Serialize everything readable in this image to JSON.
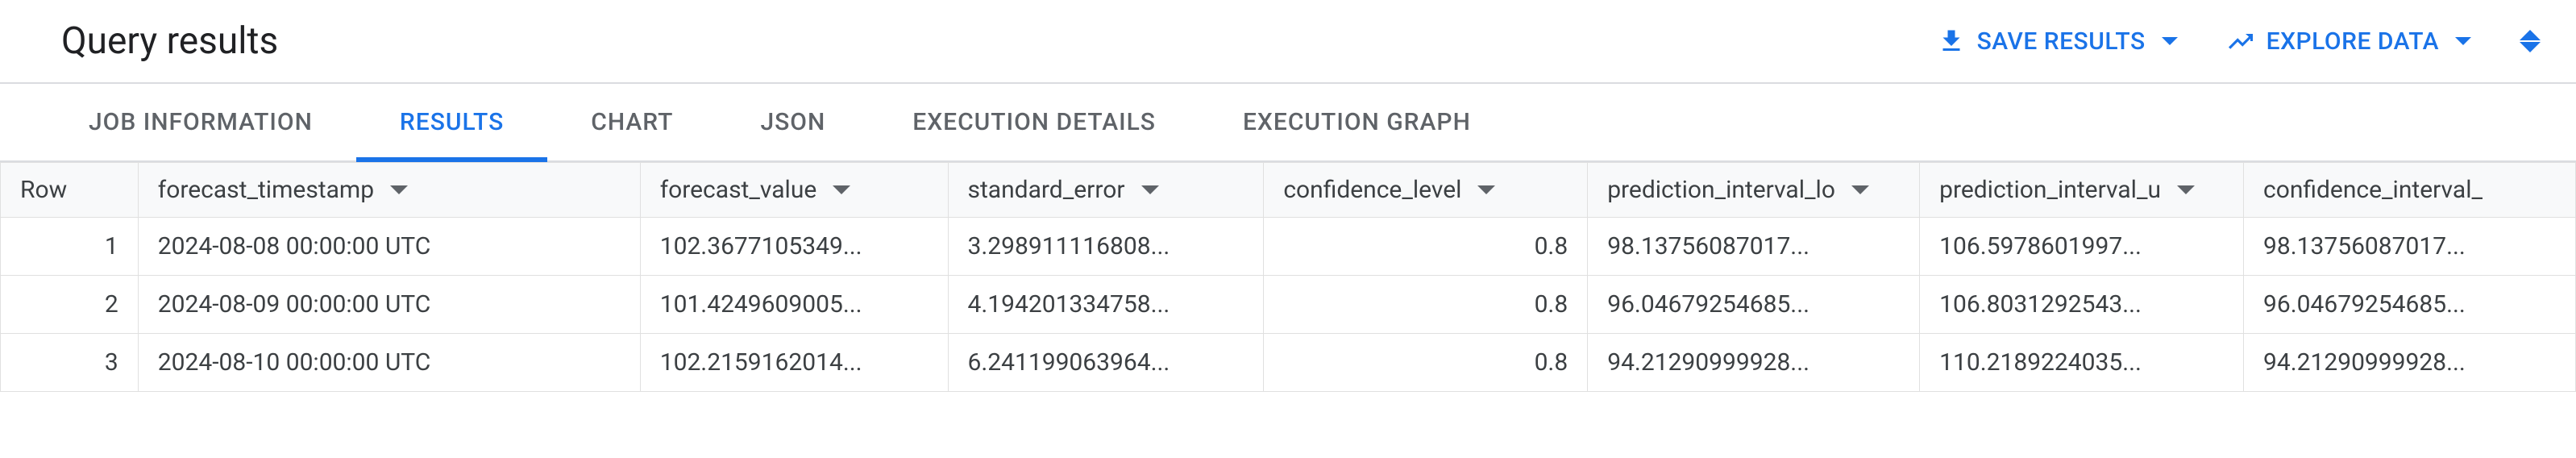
{
  "header": {
    "title": "Query results",
    "save_results_label": "SAVE RESULTS",
    "explore_data_label": "EXPLORE DATA"
  },
  "tabs": [
    {
      "label": "JOB INFORMATION",
      "active": false
    },
    {
      "label": "RESULTS",
      "active": true
    },
    {
      "label": "CHART",
      "active": false
    },
    {
      "label": "JSON",
      "active": false
    },
    {
      "label": "EXECUTION DETAILS",
      "active": false
    },
    {
      "label": "EXECUTION GRAPH",
      "active": false
    }
  ],
  "columns": {
    "row": "Row",
    "forecast_timestamp": "forecast_timestamp",
    "forecast_value": "forecast_value",
    "standard_error": "standard_error",
    "confidence_level": "confidence_level",
    "prediction_interval_lower": "prediction_interval_lo",
    "prediction_interval_upper": "prediction_interval_u",
    "confidence_interval_lower": "confidence_interval_"
  },
  "rows": [
    {
      "row": "1",
      "forecast_timestamp": "2024-08-08 00:00:00 UTC",
      "forecast_value": "102.3677105349...",
      "standard_error": "3.298911116808...",
      "confidence_level": "0.8",
      "prediction_interval_lower": "98.13756087017...",
      "prediction_interval_upper": "106.5978601997...",
      "confidence_interval_lower": "98.13756087017..."
    },
    {
      "row": "2",
      "forecast_timestamp": "2024-08-09 00:00:00 UTC",
      "forecast_value": "101.4249609005...",
      "standard_error": "4.194201334758...",
      "confidence_level": "0.8",
      "prediction_interval_lower": "96.04679254685...",
      "prediction_interval_upper": "106.8031292543...",
      "confidence_interval_lower": "96.04679254685..."
    },
    {
      "row": "3",
      "forecast_timestamp": "2024-08-10 00:00:00 UTC",
      "forecast_value": "102.2159162014...",
      "standard_error": "6.241199063964...",
      "confidence_level": "0.8",
      "prediction_interval_lower": "94.21290999928...",
      "prediction_interval_upper": "110.2189224035...",
      "confidence_interval_lower": "94.21290999928..."
    }
  ]
}
